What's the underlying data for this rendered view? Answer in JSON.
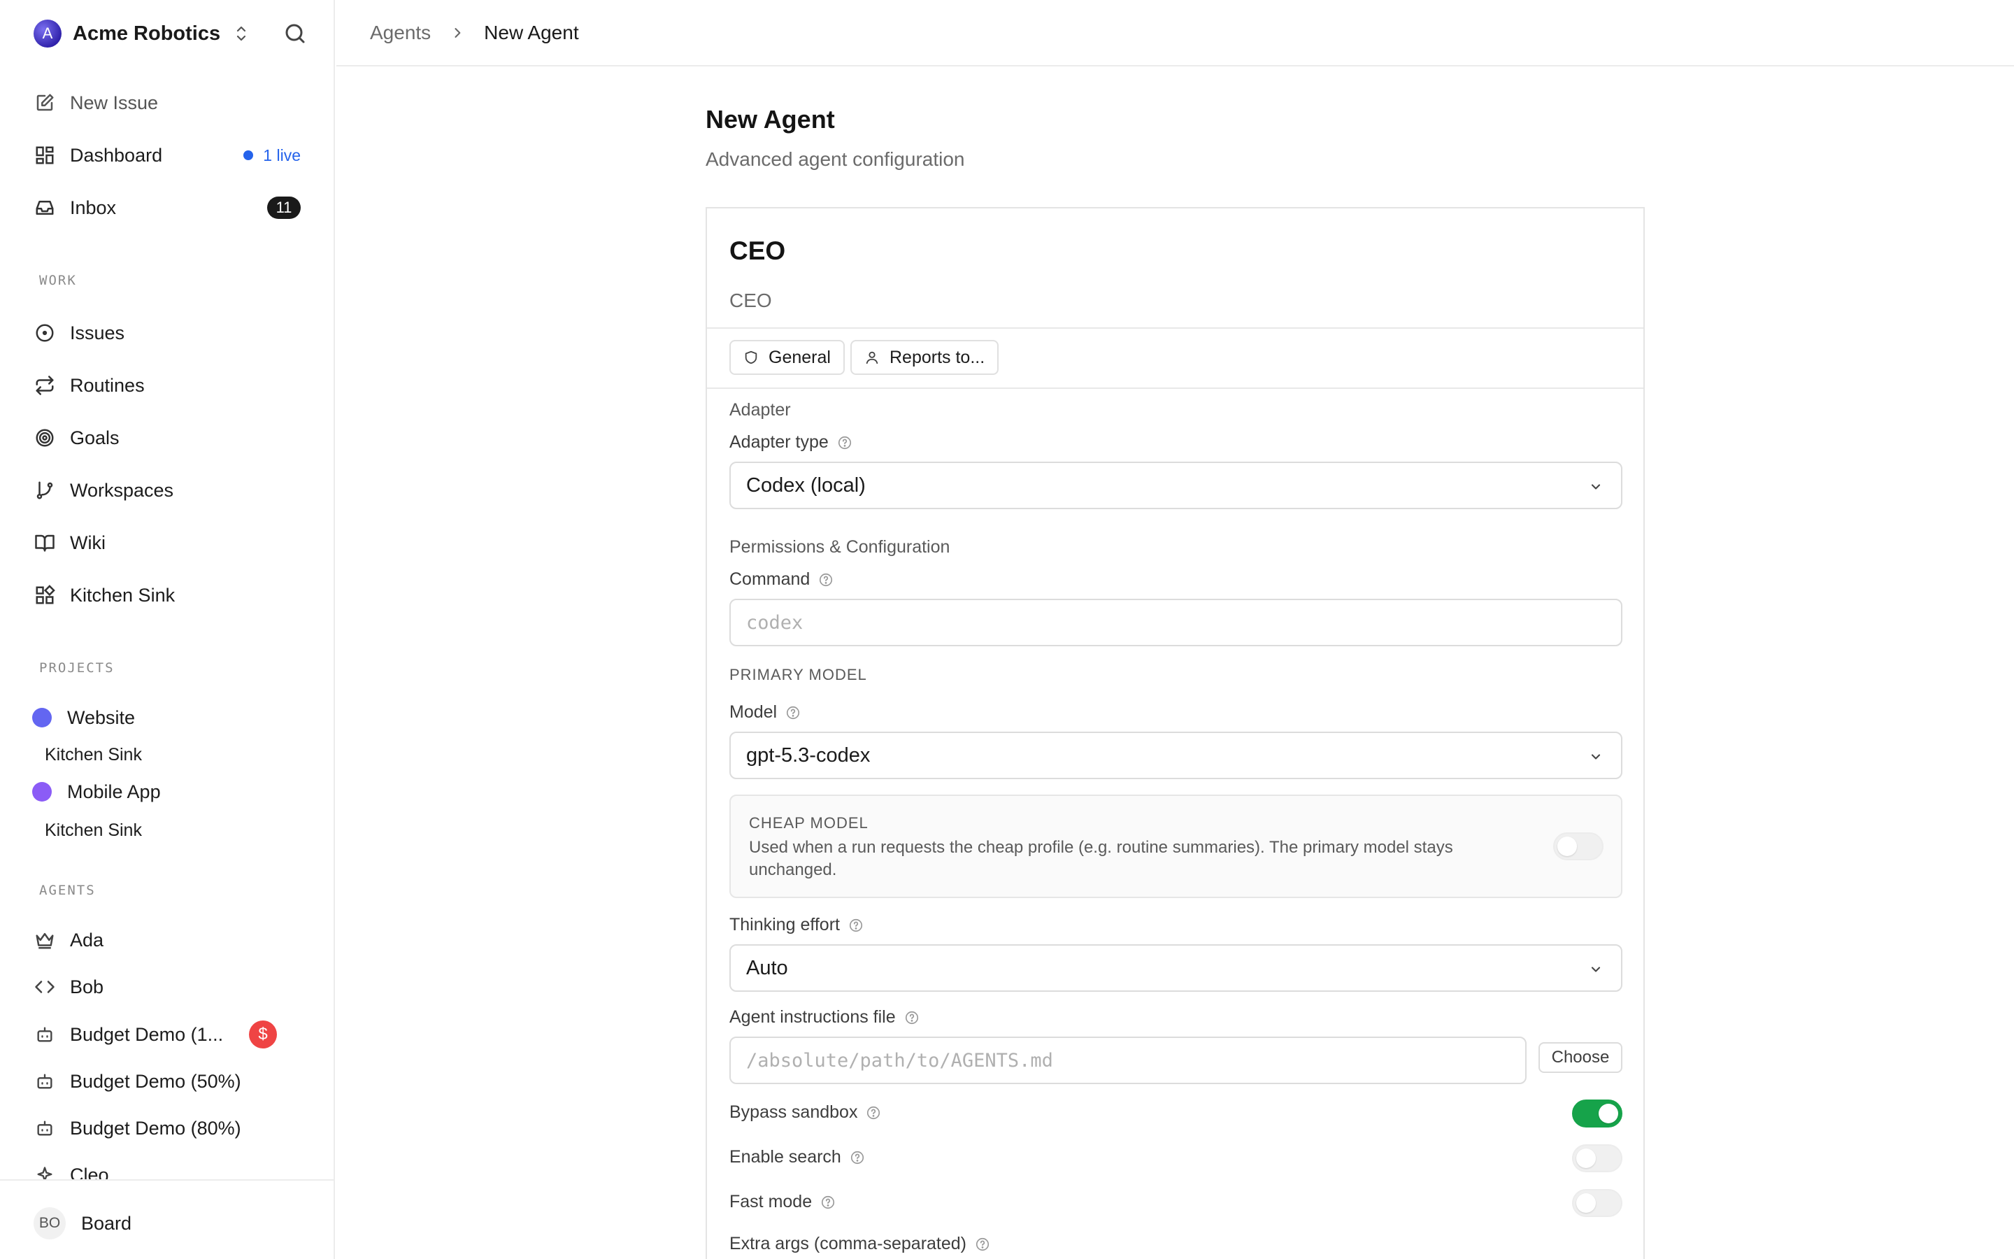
{
  "workspace": {
    "name": "Acme Robotics",
    "logo_letter": "A"
  },
  "sidebar": {
    "top_items": [
      {
        "label": "New Issue",
        "icon": "edit-icon"
      },
      {
        "label": "Dashboard",
        "icon": "dashboard-icon",
        "live_label": "1 live"
      },
      {
        "label": "Inbox",
        "icon": "inbox-icon",
        "count": "11"
      }
    ],
    "work_label": "WORK",
    "work_items": [
      {
        "label": "Issues",
        "icon": "circle-dot-icon"
      },
      {
        "label": "Routines",
        "icon": "repeat-icon"
      },
      {
        "label": "Goals",
        "icon": "target-icon"
      },
      {
        "label": "Workspaces",
        "icon": "git-branch-icon"
      },
      {
        "label": "Wiki",
        "icon": "book-icon"
      },
      {
        "label": "Kitchen Sink",
        "icon": "blocks-icon"
      }
    ],
    "projects_label": "PROJECTS",
    "projects": [
      {
        "label": "Website",
        "color": "#6366f1",
        "sub": "Kitchen Sink"
      },
      {
        "label": "Mobile App",
        "color": "#8b5cf6",
        "sub": "Kitchen Sink"
      }
    ],
    "agents_label": "AGENTS",
    "agents": [
      {
        "label": "Ada",
        "icon": "crown-icon"
      },
      {
        "label": "Bob",
        "icon": "code-icon"
      },
      {
        "label": "Budget Demo (1...",
        "icon": "bot-icon",
        "badge": "$"
      },
      {
        "label": "Budget Demo (50%)",
        "icon": "bot-icon"
      },
      {
        "label": "Budget Demo (80%)",
        "icon": "bot-icon"
      },
      {
        "label": "Cleo",
        "icon": "sparkle-icon"
      }
    ],
    "footer": {
      "initials": "BO",
      "name": "Board"
    }
  },
  "breadcrumb": {
    "parent": "Agents",
    "current": "New Agent"
  },
  "page": {
    "title": "New Agent",
    "subtitle": "Advanced agent configuration"
  },
  "agent": {
    "name": "CEO",
    "role": "CEO",
    "chips": {
      "general": "General",
      "reports_to": "Reports to..."
    }
  },
  "form": {
    "adapter_section": "Adapter",
    "adapter_type_label": "Adapter type",
    "adapter_type_value": "Codex (local)",
    "permissions_section": "Permissions & Configuration",
    "command_label": "Command",
    "command_placeholder": "codex",
    "primary_model_heading": "PRIMARY MODEL",
    "model_label": "Model",
    "model_value": "gpt-5.3-codex",
    "cheap_model_title": "CHEAP MODEL",
    "cheap_model_desc": "Used when a run requests the cheap profile (e.g. routine summaries). The primary model stays unchanged.",
    "cheap_model_enabled": false,
    "thinking_label": "Thinking effort",
    "thinking_value": "Auto",
    "instructions_label": "Agent instructions file",
    "instructions_placeholder": "/absolute/path/to/AGENTS.md",
    "choose_label": "Choose",
    "bypass_label": "Bypass sandbox",
    "bypass_enabled": true,
    "search_label": "Enable search",
    "search_enabled": false,
    "fast_label": "Fast mode",
    "fast_enabled": false,
    "extra_args_label": "Extra args (comma-separated)"
  },
  "colors": {
    "accent": "#2563eb",
    "toggle_on": "#16a34a",
    "danger": "#ef4444"
  }
}
